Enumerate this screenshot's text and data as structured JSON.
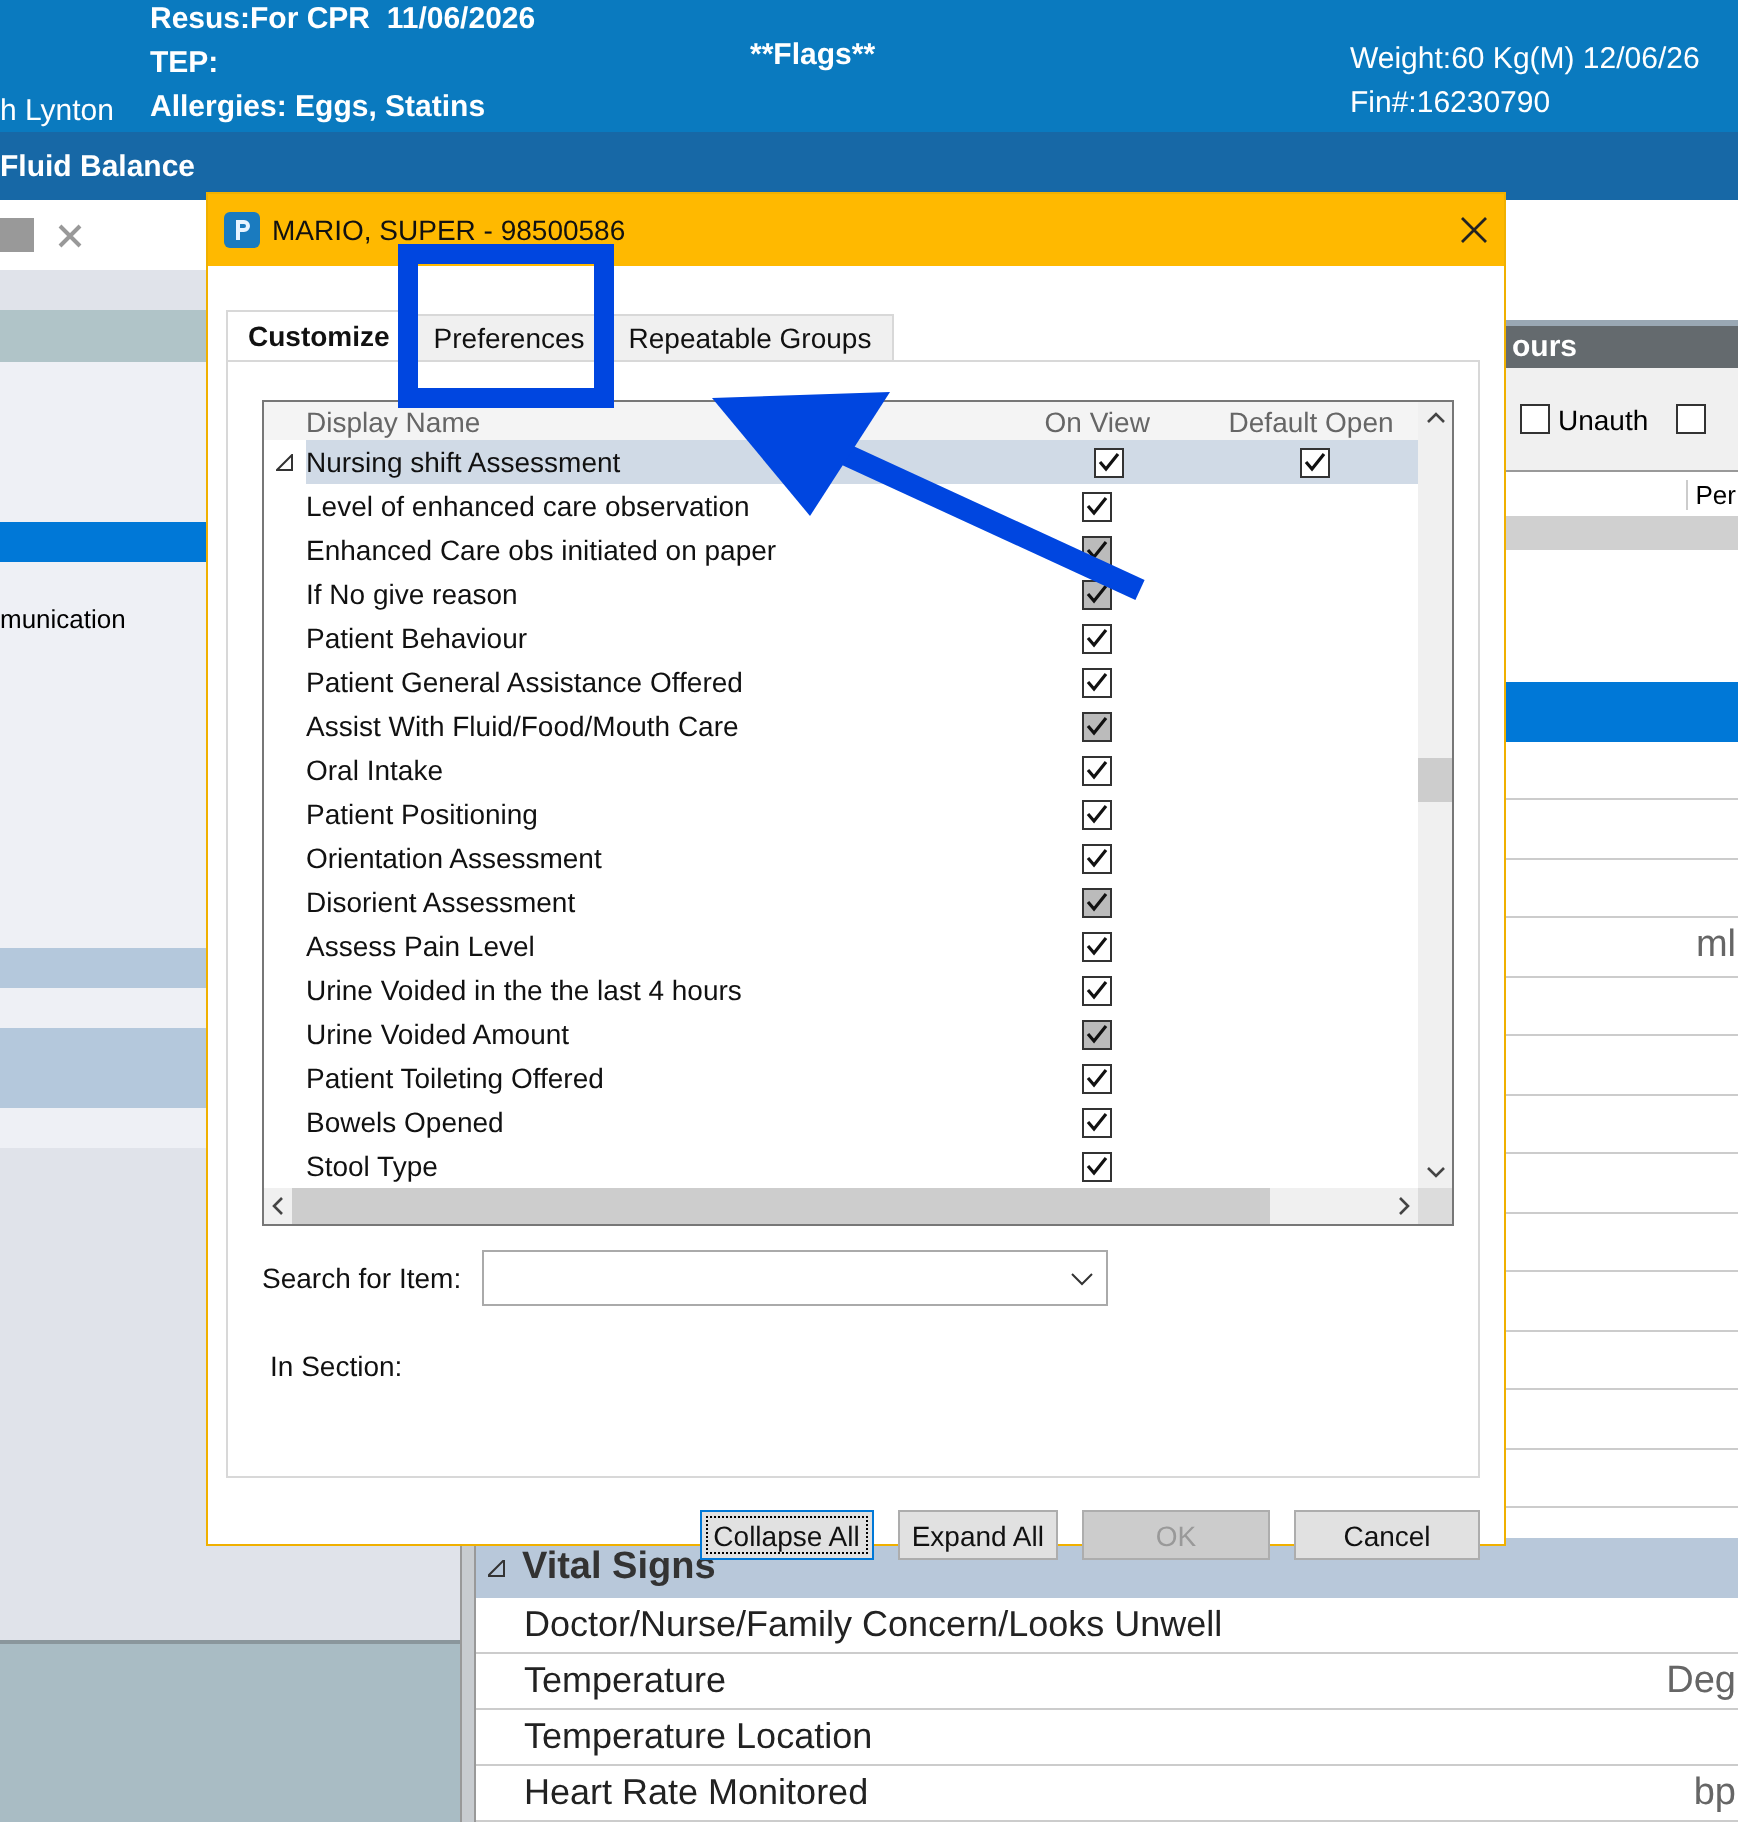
{
  "header": {
    "patient_name": "h Lynton",
    "resus": "Resus:For CPR  11/06/2026",
    "tep": "TEP:",
    "allergies": "Allergies: Eggs, Statins",
    "flags": "**Flags**",
    "weight": "Weight:60 Kg(M) 12/06/26",
    "fin": "Fin#:16230790"
  },
  "title_bar": {
    "title": "Fluid Balance"
  },
  "left_panel": {
    "rows": [
      {
        "label": "",
        "selected": true
      },
      {
        "label": "munication",
        "selected": false
      }
    ]
  },
  "right_panel": {
    "header": "ours",
    "filters": [
      {
        "label": "Unauth",
        "checked": false
      },
      {
        "checked": false
      }
    ],
    "column_header": "Per",
    "rows": [
      {
        "unit": "",
        "selected": true
      },
      {
        "unit": "",
        "selected": false
      },
      {
        "unit": "",
        "selected": false
      },
      {
        "unit": "",
        "selected": false
      },
      {
        "unit": "ml",
        "selected": false
      },
      {
        "unit": "",
        "selected": false
      },
      {
        "unit": "",
        "selected": false
      },
      {
        "unit": "",
        "selected": false
      },
      {
        "unit": "",
        "selected": false
      },
      {
        "unit": "",
        "selected": false
      },
      {
        "unit": "",
        "selected": false
      },
      {
        "unit": "",
        "selected": false
      },
      {
        "unit": "",
        "selected": false
      },
      {
        "unit": "",
        "selected": false
      }
    ],
    "section": {
      "title": "Vital Signs",
      "expanded": true,
      "rows": [
        {
          "label": "Doctor/Nurse/Family Concern/Looks Unwell",
          "unit": ""
        },
        {
          "label": "Temperature",
          "unit": "Deg"
        },
        {
          "label": "Temperature Location",
          "unit": ""
        },
        {
          "label": "Heart Rate Monitored",
          "unit": "bp"
        }
      ]
    }
  },
  "dialog": {
    "title": "MARIO, SUPER - 98500586",
    "tabs": [
      {
        "label": "Customize",
        "selected": true
      },
      {
        "label": "Preferences",
        "selected": false
      },
      {
        "label": "Repeatable Groups",
        "selected": false
      }
    ],
    "columns": [
      "Display Name",
      "On View",
      "Default Open"
    ],
    "items": [
      {
        "name": "Nursing shift Assessment",
        "selected": true,
        "expanded": true,
        "on_view": {
          "checked": true,
          "disabled": false
        },
        "default_open": {
          "checked": true
        }
      },
      {
        "name": "Level of enhanced care observation",
        "selected": false,
        "on_view": {
          "checked": true,
          "disabled": false
        }
      },
      {
        "name": "Enhanced Care obs initiated on paper",
        "selected": false,
        "on_view": {
          "checked": true,
          "disabled": true
        }
      },
      {
        "name": "If No give reason",
        "selected": false,
        "on_view": {
          "checked": true,
          "disabled": true
        }
      },
      {
        "name": "Patient Behaviour",
        "selected": false,
        "on_view": {
          "checked": true,
          "disabled": false
        }
      },
      {
        "name": "Patient General Assistance Offered",
        "selected": false,
        "on_view": {
          "checked": true,
          "disabled": false
        }
      },
      {
        "name": "Assist With Fluid/Food/Mouth Care",
        "selected": false,
        "on_view": {
          "checked": true,
          "disabled": true
        }
      },
      {
        "name": "Oral Intake",
        "selected": false,
        "on_view": {
          "checked": true,
          "disabled": false
        }
      },
      {
        "name": "Patient Positioning",
        "selected": false,
        "on_view": {
          "checked": true,
          "disabled": false
        }
      },
      {
        "name": "Orientation Assessment",
        "selected": false,
        "on_view": {
          "checked": true,
          "disabled": false
        }
      },
      {
        "name": "Disorient Assessment",
        "selected": false,
        "on_view": {
          "checked": true,
          "disabled": true
        }
      },
      {
        "name": "Assess Pain Level",
        "selected": false,
        "on_view": {
          "checked": true,
          "disabled": false
        }
      },
      {
        "name": "Urine Voided in the the last 4 hours",
        "selected": false,
        "on_view": {
          "checked": true,
          "disabled": false
        }
      },
      {
        "name": "Urine Voided Amount",
        "selected": false,
        "on_view": {
          "checked": true,
          "disabled": true
        }
      },
      {
        "name": "Patient Toileting Offered",
        "selected": false,
        "on_view": {
          "checked": true,
          "disabled": false
        }
      },
      {
        "name": "Bowels Opened",
        "selected": false,
        "on_view": {
          "checked": true,
          "disabled": false
        }
      },
      {
        "name": "Stool Type",
        "selected": false,
        "on_view": {
          "checked": true,
          "disabled": false
        }
      }
    ],
    "search_label": "Search for Item:",
    "section_label": "In Section:",
    "buttons": [
      {
        "label": "Collapse All",
        "focused": true,
        "disabled": false
      },
      {
        "label": "Expand All",
        "focused": false,
        "disabled": false
      },
      {
        "label": "OK",
        "focused": false,
        "disabled": true
      },
      {
        "label": "Cancel",
        "focused": false,
        "disabled": false
      }
    ]
  }
}
